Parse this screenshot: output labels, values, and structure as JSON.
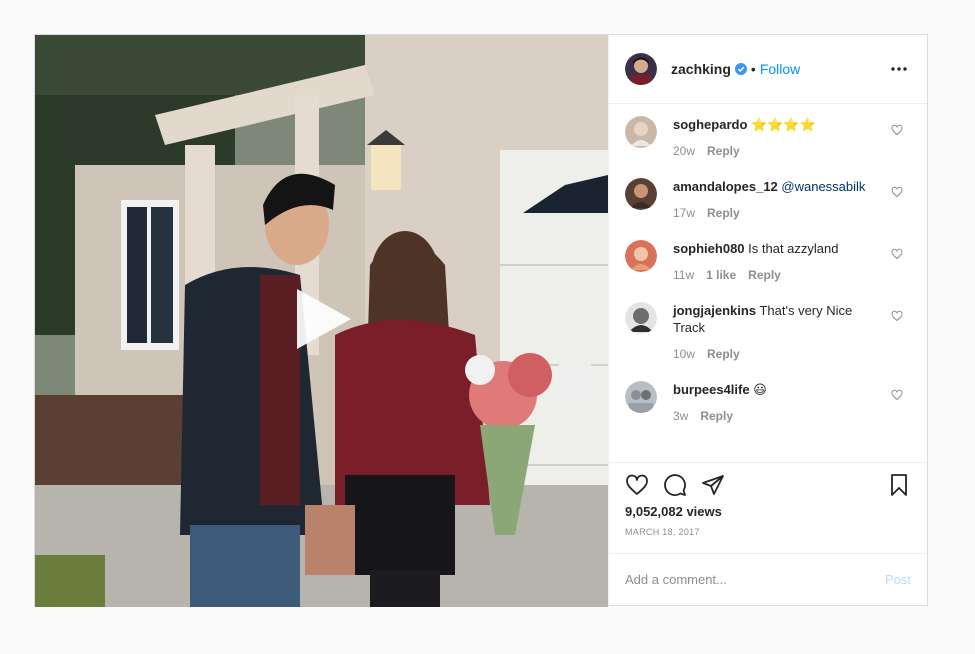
{
  "post": {
    "author": "zachking",
    "follow_label": "Follow",
    "separator": "•",
    "views": "9,052,082 views",
    "date": "MARCH 18, 2017"
  },
  "comments": [
    {
      "user": "soghepardo",
      "text": "⭐⭐⭐⭐",
      "mention": "",
      "age": "20w",
      "likes": "",
      "reply": "Reply",
      "avatar_color": "#c9b7a8"
    },
    {
      "user": "amandalopes_12",
      "text": "",
      "mention": "@wanessabilk",
      "age": "17w",
      "likes": "",
      "reply": "Reply",
      "avatar_color": "#5a3f35"
    },
    {
      "user": "sophieh080",
      "text": "Is that azzyland",
      "mention": "",
      "age": "11w",
      "likes": "1 like",
      "reply": "Reply",
      "avatar_color": "#d8735a"
    },
    {
      "user": "jongjajenkins",
      "text": "That's very Nice Track",
      "mention": "",
      "age": "10w",
      "likes": "",
      "reply": "Reply",
      "avatar_color": "#6d6d6d"
    },
    {
      "user": "burpees4life",
      "text": "😃",
      "mention": "",
      "age": "3w",
      "likes": "",
      "reply": "Reply",
      "avatar_color": "#8a8f96"
    }
  ],
  "add_comment": {
    "placeholder": "Add a comment...",
    "post_label": "Post"
  },
  "colors": {
    "accent": "#0095f6",
    "muted": "#8e8e8e",
    "post_disabled": "#b2dffc"
  }
}
